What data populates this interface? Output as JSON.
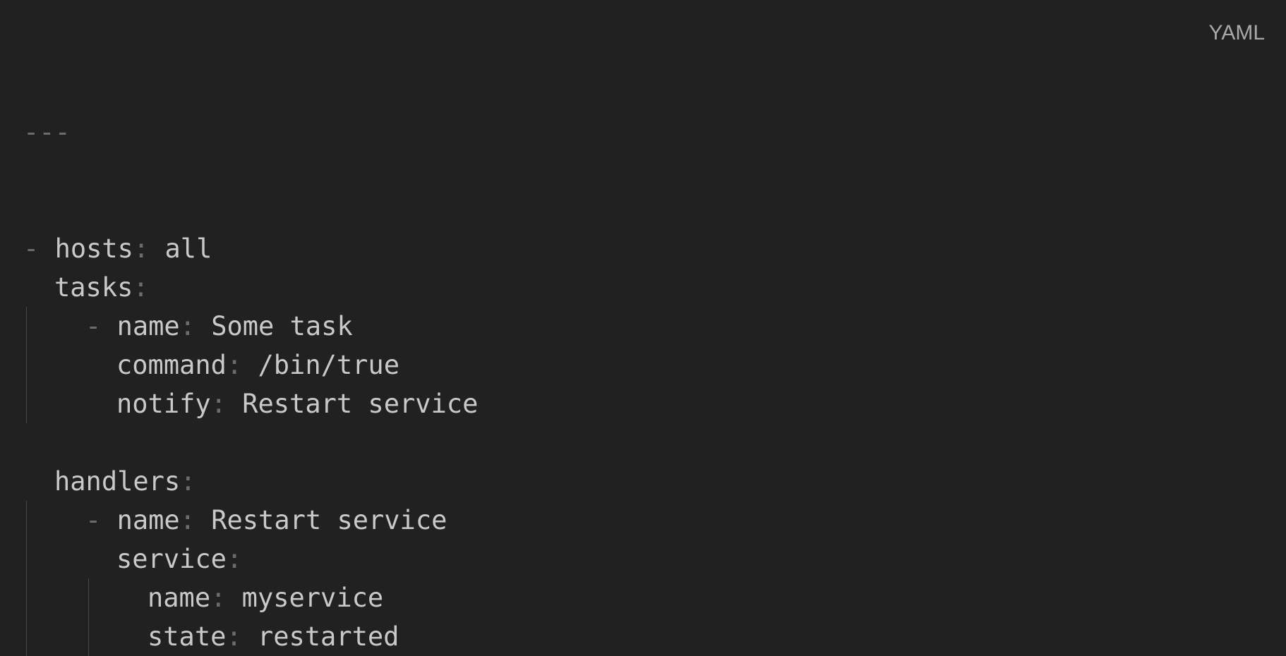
{
  "language": "YAML",
  "doc_start": "---",
  "lines": [
    {
      "indent": 0,
      "guides": [],
      "dash": "-",
      "key": "hosts",
      "value": "all"
    },
    {
      "indent": 1,
      "guides": [],
      "dash": "",
      "key": "tasks",
      "value": ""
    },
    {
      "indent": 2,
      "guides": [
        0
      ],
      "dash": "-",
      "key": "name",
      "value": "Some task"
    },
    {
      "indent": 3,
      "guides": [
        0
      ],
      "dash": "",
      "key": "command",
      "value": "/bin/true"
    },
    {
      "indent": 3,
      "guides": [
        0
      ],
      "dash": "",
      "key": "notify",
      "value": "Restart service"
    },
    {
      "indent": 0,
      "guides": [],
      "dash": "",
      "key": "",
      "value": ""
    },
    {
      "indent": 1,
      "guides": [],
      "dash": "",
      "key": "handlers",
      "value": ""
    },
    {
      "indent": 2,
      "guides": [
        0
      ],
      "dash": "-",
      "key": "name",
      "value": "Restart service"
    },
    {
      "indent": 3,
      "guides": [
        0
      ],
      "dash": "",
      "key": "service",
      "value": ""
    },
    {
      "indent": 4,
      "guides": [
        0,
        2
      ],
      "dash": "",
      "key": "name",
      "value": "myservice"
    },
    {
      "indent": 4,
      "guides": [
        0,
        2
      ],
      "dash": "",
      "key": "state",
      "value": "restarted"
    }
  ]
}
